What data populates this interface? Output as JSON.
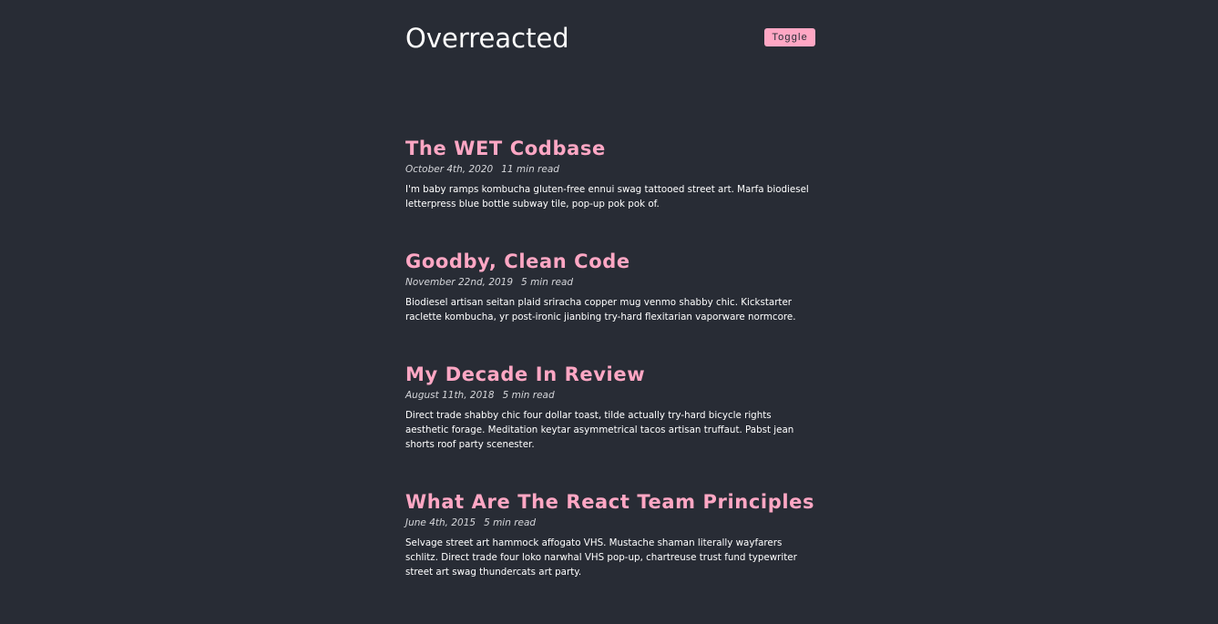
{
  "site": {
    "title": "Overreacted",
    "toggle_label": "Toggle"
  },
  "colors": {
    "background": "#282c35",
    "accent": "#ffa7c4",
    "text": "#ffffff"
  },
  "posts": [
    {
      "title": "The WET Codbase",
      "date": "October 4th, 2020",
      "read_time": "11 min read",
      "excerpt": "I'm baby ramps kombucha gluten-free ennui swag tattooed street art. Marfa biodiesel letterpress blue bottle subway tile, pop-up pok pok of."
    },
    {
      "title": "Goodby, Clean Code",
      "date": "November 22nd, 2019",
      "read_time": "5 min read",
      "excerpt": "Biodiesel artisan seitan plaid sriracha copper mug venmo shabby chic. Kickstarter raclette kombucha, yr post-ironic jianbing try-hard flexitarian vaporware normcore."
    },
    {
      "title": "My Decade In Review",
      "date": "August 11th, 2018",
      "read_time": "5 min read",
      "excerpt": "Direct trade shabby chic four dollar toast, tilde actually try-hard bicycle rights aesthetic forage. Meditation keytar asymmetrical tacos artisan truffaut. Pabst jean shorts roof party scenester."
    },
    {
      "title": "What Are The React Team Principles",
      "date": "June 4th, 2015",
      "read_time": "5 min read",
      "excerpt": "Selvage street art hammock affogato VHS. Mustache shaman literally wayfarers schlitz. Direct trade four loko narwhal VHS pop-up, chartreuse trust fund typewriter street art swag thundercats art party."
    }
  ]
}
